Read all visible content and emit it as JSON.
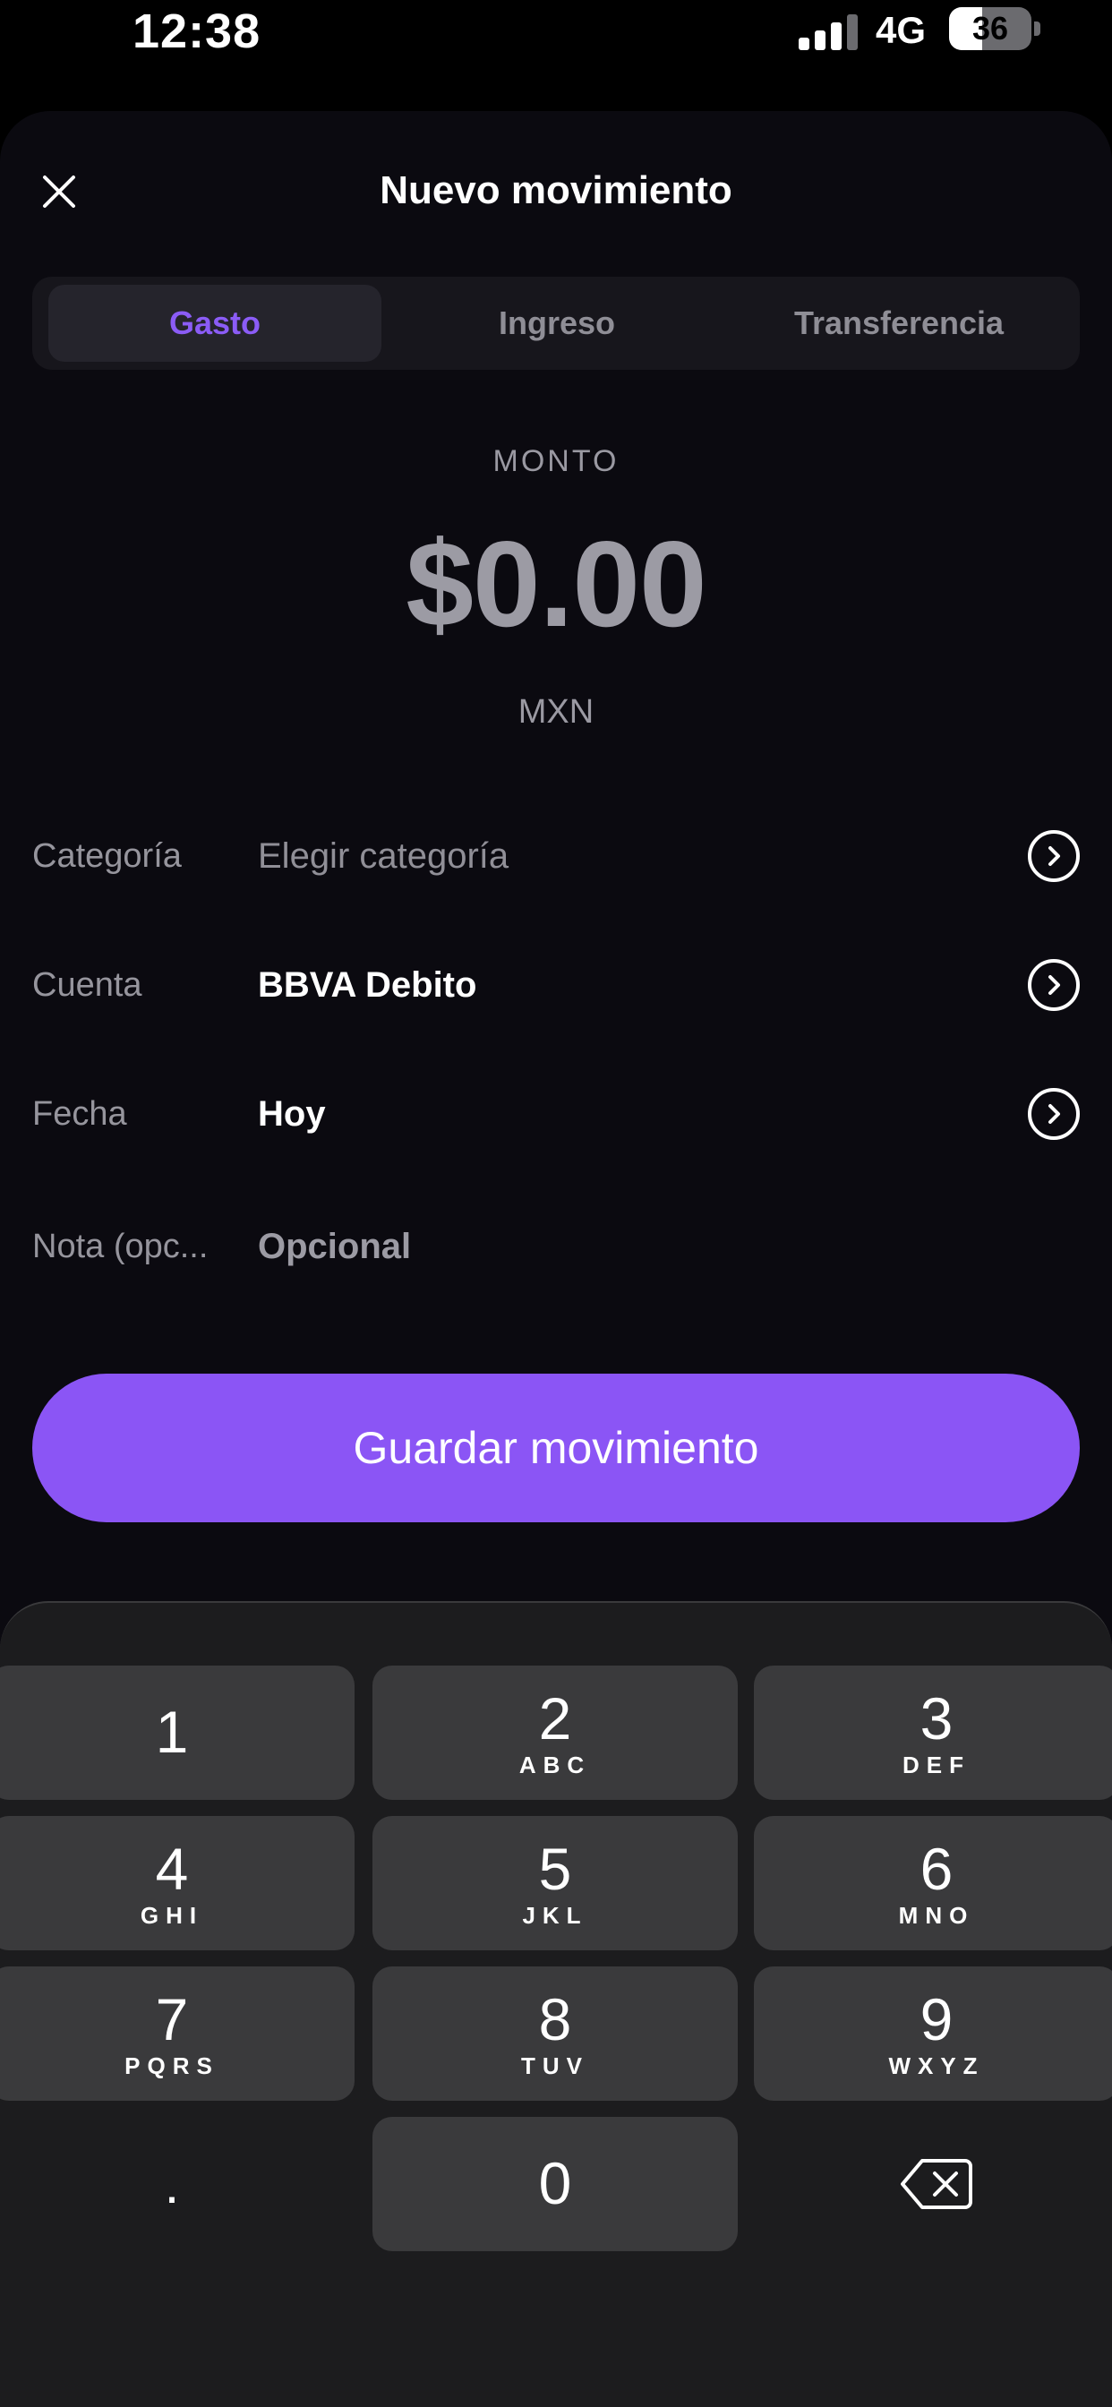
{
  "status_bar": {
    "time": "12:38",
    "network": "4G",
    "battery": "36"
  },
  "sheet": {
    "title": "Nuevo movimiento"
  },
  "tabs": [
    {
      "label": "Gasto",
      "active": true
    },
    {
      "label": "Ingreso",
      "active": false
    },
    {
      "label": "Transferencia",
      "active": false
    }
  ],
  "amount": {
    "label": "MONTO",
    "value": "$0.00",
    "currency": "MXN"
  },
  "fields": {
    "category": {
      "label": "Categoría",
      "value": "Elegir categoría"
    },
    "account": {
      "label": "Cuenta",
      "value": "BBVA Debito"
    },
    "date": {
      "label": "Fecha",
      "value": "Hoy"
    },
    "note": {
      "label": "Nota (opc...",
      "placeholder": "Opcional"
    }
  },
  "save_button": "Guardar movimiento",
  "keypad": {
    "k1": {
      "digit": "1",
      "letters": ""
    },
    "k2": {
      "digit": "2",
      "letters": "ABC"
    },
    "k3": {
      "digit": "3",
      "letters": "DEF"
    },
    "k4": {
      "digit": "4",
      "letters": "GHI"
    },
    "k5": {
      "digit": "5",
      "letters": "JKL"
    },
    "k6": {
      "digit": "6",
      "letters": "MNO"
    },
    "k7": {
      "digit": "7",
      "letters": "PQRS"
    },
    "k8": {
      "digit": "8",
      "letters": "TUV"
    },
    "k9": {
      "digit": "9",
      "letters": "WXYZ"
    },
    "k0": {
      "digit": "0",
      "letters": ""
    },
    "dot": "."
  },
  "icons": {
    "close": "close-icon",
    "chevron": "chevron-right-circle-icon",
    "backspace": "backspace-icon"
  },
  "colors": {
    "accent": "#8b55f5",
    "active_tab_text": "#8b5cf6",
    "background": "#0b0a10"
  }
}
